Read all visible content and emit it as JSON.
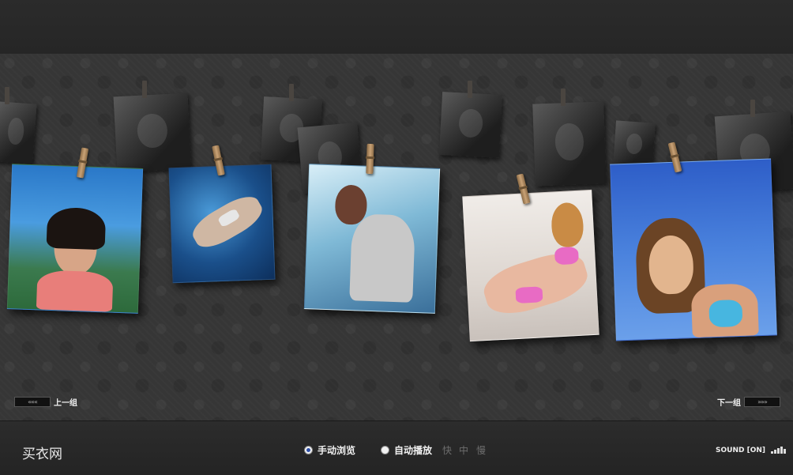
{
  "gallery": {
    "prev_label": "上一组",
    "next_label": "下一组",
    "prev_arrows": "«««",
    "next_arrows": "»»»"
  },
  "footer": {
    "brand": "买衣网",
    "manual_label": "手动浏览",
    "auto_label": "自动播放",
    "speed_fast": "快",
    "speed_medium": "中",
    "speed_slow": "慢",
    "sound_label": "SOUND [ON]",
    "mode_selected": "manual"
  },
  "colors": {
    "background": "#363636",
    "bars": "#282828",
    "clip": "#c9a276",
    "radio_selected": "#2d4ea8"
  },
  "icons": {
    "prev": "triple-chevron-left-icon",
    "next": "triple-chevron-right-icon",
    "sound": "sound-level-icon"
  }
}
